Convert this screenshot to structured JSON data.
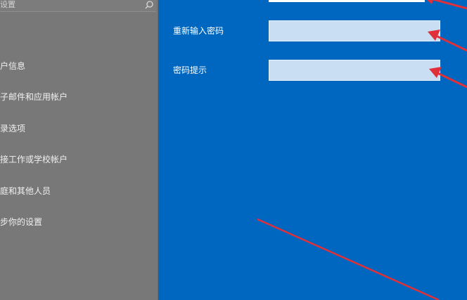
{
  "sidebar": {
    "search_placeholder": "设置",
    "items": [
      {
        "label": "户信息"
      },
      {
        "label": "子邮件和应用帐户"
      },
      {
        "label": "录选项"
      },
      {
        "label": "接工作或学校帐户"
      },
      {
        "label": "庭和其他人员"
      },
      {
        "label": "步你的设置"
      }
    ]
  },
  "form": {
    "reenter_password_label": "重新输入密码",
    "password_hint_label": "密码提示"
  },
  "colors": {
    "background": "#0067c0",
    "sidebar": "#787878",
    "field": "#c9def2",
    "annotation_arrow": "#e0303a"
  }
}
